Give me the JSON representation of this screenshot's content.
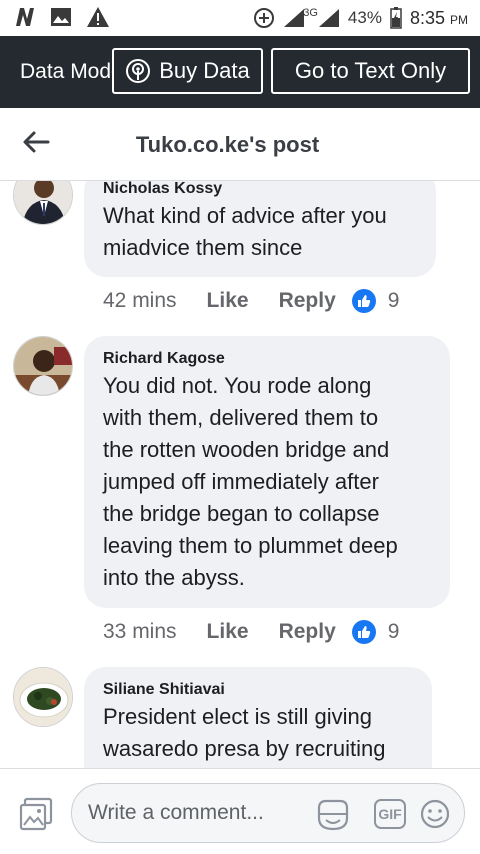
{
  "status_bar": {
    "battery": "43%",
    "network": "3G",
    "time": "8:35",
    "time_suffix": "PM",
    "left_icons": [
      "n-icon",
      "image-icon",
      "warning-icon"
    ]
  },
  "banner": {
    "text": "Data Mode",
    "buy_data_label": "Buy Data",
    "text_only_label": "Go to Text Only"
  },
  "header": {
    "title": "Tuko.co.ke's post"
  },
  "comments": [
    {
      "author": "Nicholas Kossy",
      "lines": [
        "What kind of advice after you",
        "miadvice them since"
      ],
      "time": "42 mins",
      "like_label": "Like",
      "reply_label": "Reply",
      "reactions": "9"
    },
    {
      "author": "Richard Kagose",
      "lines": [
        "You did not. You rode along",
        "with them, delivered them to",
        "the rotten wooden bridge and",
        "jumped off immediately after",
        "the bridge began to collapse",
        "leaving them to plummet deep",
        "into the abyss."
      ],
      "time": "33 mins",
      "like_label": "Like",
      "reply_label": "Reply",
      "reactions": "9"
    },
    {
      "author": "Siliane Shitiavai",
      "lines": [
        "President elect is still giving",
        "wasaredo presa by recruiting"
      ]
    }
  ],
  "composer": {
    "placeholder": "Write a comment...",
    "gif_label": "GIF"
  },
  "colors": {
    "banner_bg": "#252a31",
    "bubble_bg": "#f0f1f4",
    "like_blue": "#1877f2"
  }
}
